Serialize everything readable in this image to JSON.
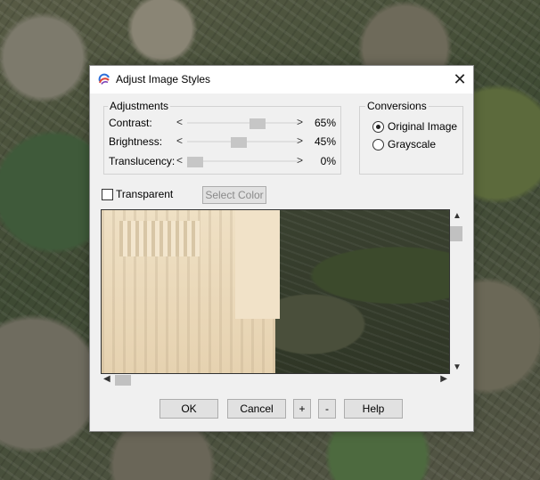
{
  "dialog": {
    "title": "Adjust Image Styles",
    "close": "✕"
  },
  "adjustments": {
    "label": "Adjustments",
    "rows": [
      {
        "label": "Contrast:",
        "value_text": "65%",
        "level": 0.65
      },
      {
        "label": "Brightness:",
        "value_text": "45%",
        "level": 0.45
      },
      {
        "label": "Translucency:",
        "value_text": "0%",
        "level": 0.0
      }
    ]
  },
  "conversions": {
    "label": "Conversions",
    "options": [
      {
        "label": "Original Image",
        "selected": true
      },
      {
        "label": "Grayscale",
        "selected": false
      }
    ]
  },
  "transparent": {
    "label": "Transparent",
    "checked": false
  },
  "select_color": "Select Color",
  "buttons": {
    "ok": "OK",
    "cancel": "Cancel",
    "plus": "+",
    "minus": "-",
    "help": "Help"
  }
}
